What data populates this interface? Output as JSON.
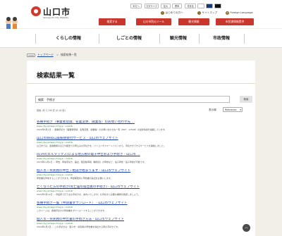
{
  "header": {
    "site_name": "山口市",
    "site_sub": "Yamaguchi City Website",
    "util_buttons": [
      "本文へ",
      "文字サイズ",
      "拡大",
      "標準",
      "背景色"
    ],
    "util_links": [
      "はじめての方へ",
      "サイトマップ",
      "Foreign Language"
    ],
    "red_buttons": [
      "検索する",
      "山口市防災メール",
      "観光情報",
      "市民課情報提供"
    ]
  },
  "gnav": [
    "くらしの情報",
    "しごとの情報",
    "観光情報",
    "市政情報"
  ],
  "breadcrumb": {
    "home": "HOME",
    "link": "トップページ",
    "sep": ">",
    "current": "検索結果一覧"
  },
  "page_title": "検索結果一覧",
  "search": {
    "value": "検索　手続き",
    "button": "検索"
  },
  "result_count": "検索: 約 3,790 件 (0.16 秒)",
  "sort": {
    "label": "表示順",
    "value": "Relevance"
  },
  "results": [
    {
      "title": "各種手続き（事業者登録、名義変更、廃業等）のお問い合わせ先 ...",
      "url": "www.city.yamaguchi.lg.jp › soshiki",
      "snippet": "2022年6月1日 ... 各種手続き（事業者登録、名義変更、廃業等）のお問い合わせ先一覧（PDF：125KB）の最新情報を掲載しています。"
    },
    {
      "title": "山口市Web口座振替受付サービス - 山口市ウェブサイト",
      "url": "www.city.yamaguchi.lg.jp › soshiki",
      "snippet": "山口市では、金融機関の窓口や郵送での申込みの手続きを、パソコンやスマートフォンから、手続きができるサービスを開始しました。"
    },
    {
      "title": "eLTAX(エルタックス)による地方税の電子申告および手続き - 山口市 ...",
      "url": "www.city.yamaguchi.lg.jp › soshiki",
      "snippet": "2023年11月1日 ... 申告、申請手続き、届出、軽自動車税（種別割）の申告など、電子申告・電子申請が可能です。"
    },
    {
      "title": "個人市・県民税の申告・相談が始まります - 山口市ウェブサイト",
      "url": "www.city.yamaguchi.lg.jp › soshiki",
      "snippet": "申告書を作成することができます。申告期限内に申告書の提出をお願いします。"
    },
    {
      "title": "亡くなった方の手続き(死亡届の提出後の手続き) - 山口市ウェブサイト",
      "url": "www.city.yamaguchi.lg.jp › soshiki",
      "snippet": "2024年3月14日 ... 市役所で行う主な手続きを、案内いたします。お手続きに必要な書類を確認しましょう。"
    },
    {
      "title": "各種手続き一覧（申請書ダウンロード） - 山口市ウェブサイト",
      "url": "www.city.yamaguchi.lg.jp › soshiki",
      "snippet": "このページは、各種手続きの申請書をダウンロードすることができます。"
    },
    {
      "title": "個人市・県民税の申告書の手続き方法 - 山口市ウェブサイト",
      "url": "www.city.yamaguchi.lg.jp › soshiki",
      "snippet": "2024年1月1日 ... この手続きは、個人市・県民税の申告書を提出する際の手続きです。"
    }
  ]
}
